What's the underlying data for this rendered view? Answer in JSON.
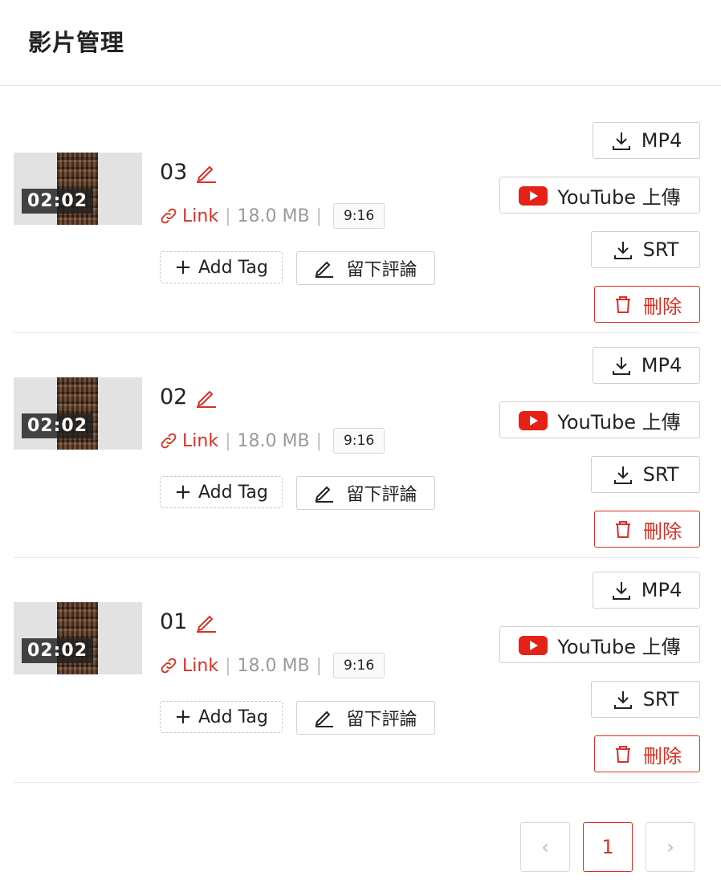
{
  "header": {
    "title": "影片管理"
  },
  "videos": [
    {
      "name": "03",
      "duration": "02:02",
      "link_label": "Link",
      "size": "18.0 MB",
      "ratio": "9:16"
    },
    {
      "name": "02",
      "duration": "02:02",
      "link_label": "Link",
      "size": "18.0 MB",
      "ratio": "9:16"
    },
    {
      "name": "01",
      "duration": "02:02",
      "link_label": "Link",
      "size": "18.0 MB",
      "ratio": "9:16"
    }
  ],
  "labels": {
    "add_tag": "Add Tag",
    "comment": "留下評論",
    "mp4": "MP4",
    "youtube": "YouTube 上傳",
    "srt": "SRT",
    "delete": "刪除",
    "separator": "|"
  },
  "pagination": {
    "current": "1",
    "prev": "‹",
    "next": "›"
  },
  "colors": {
    "accent": "#d93025",
    "youtube": "#e62117"
  }
}
